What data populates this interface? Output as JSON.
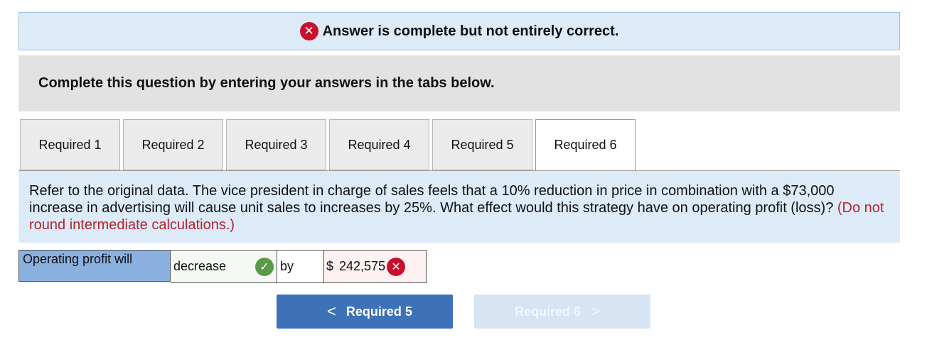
{
  "banner": {
    "message": "Answer is complete but not entirely correct.",
    "icon": "x-circle-icon",
    "color": "#c8102e"
  },
  "instructions": "Complete this question by entering your answers in the tabs below.",
  "tabs": [
    {
      "label": "Required 1"
    },
    {
      "label": "Required 2"
    },
    {
      "label": "Required 3"
    },
    {
      "label": "Required 4"
    },
    {
      "label": "Required 5"
    },
    {
      "label": "Required 6",
      "active": true
    }
  ],
  "question": {
    "text": "Refer to the original data. The vice president in charge of sales feels that a 10% reduction in price in combination with a $73,000 increase in advertising will cause unit sales to increases by 25%. What effect would this strategy have on operating profit (loss)?",
    "note": "(Do not round intermediate calculations.)"
  },
  "answer": {
    "label": "Operating profit will",
    "direction": "decrease",
    "direction_correct": true,
    "by": "by",
    "currency": "$",
    "amount": "242,575",
    "amount_correct": false
  },
  "nav": {
    "prev_label": "Required 5",
    "next_label": "Required 6"
  }
}
